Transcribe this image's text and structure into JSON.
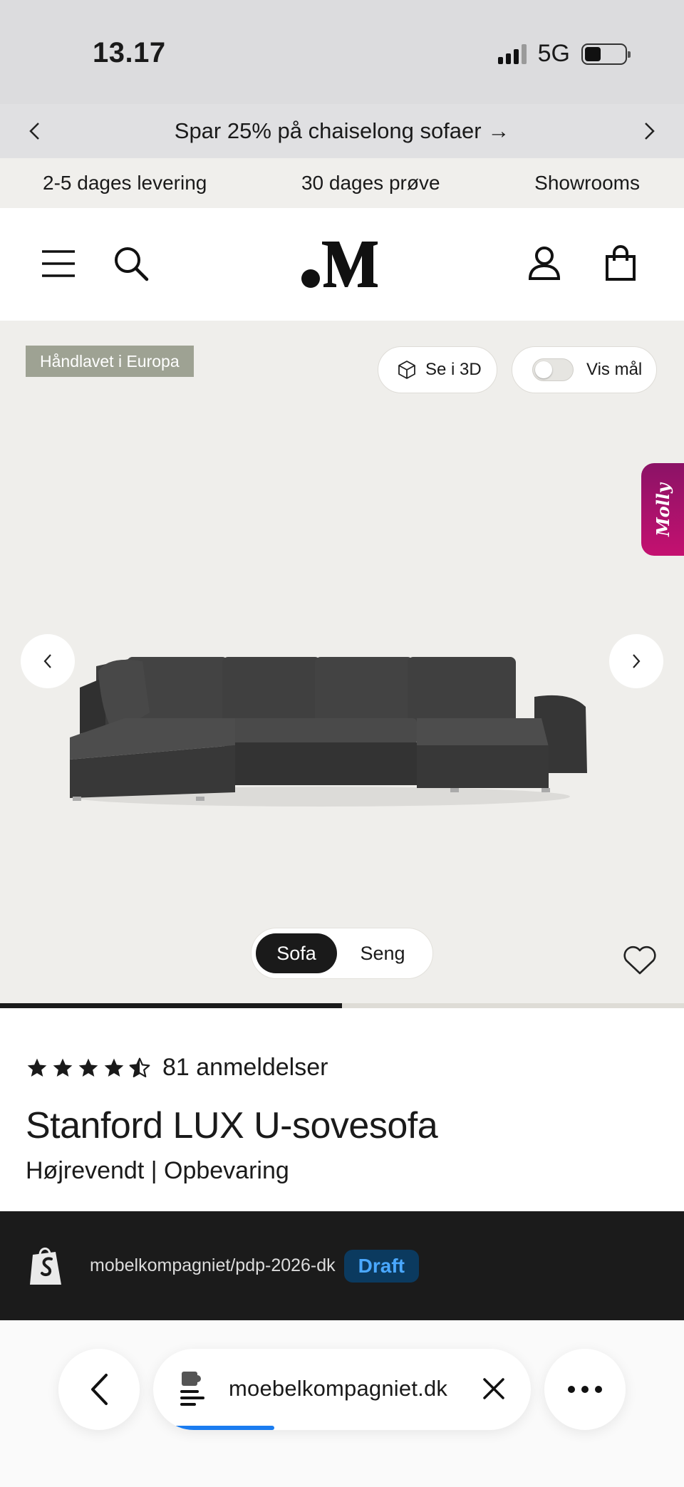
{
  "status_bar": {
    "time": "13.17",
    "network": "5G"
  },
  "promo": {
    "text": "Spar 25% på chaiselong sofaer →"
  },
  "usp": {
    "items": [
      "2-5 dages levering",
      "30 dages prøve",
      "Showrooms"
    ]
  },
  "header": {
    "logo_alt": "M"
  },
  "hero": {
    "badge": "Håndlavet i Europa",
    "view_3d_label": "Se i 3D",
    "show_measurements_label": "Vis mål",
    "show_measurements_on": false,
    "assistant_label": "Molly",
    "variant_options": [
      "Sofa",
      "Seng"
    ],
    "variant_selected": "Sofa",
    "gallery_progress": 0.5
  },
  "product": {
    "rating": 4.5,
    "reviews_label": "81 anmeldelser",
    "title": "Stanford LUX U-sovesofa",
    "subtitle": "Højrevendt | Opbevaring"
  },
  "preview": {
    "path": "mobelkompagniet/pdp-2026-dk",
    "status": "Draft"
  },
  "browser": {
    "url": "moebelkompagniet.dk",
    "load_progress": 0.36
  },
  "colors": {
    "accent_progress": "#1a7cf0",
    "badge_bg": "#9ea293",
    "draft_text": "#4aa8ff",
    "molly_pink": "#c41170"
  }
}
